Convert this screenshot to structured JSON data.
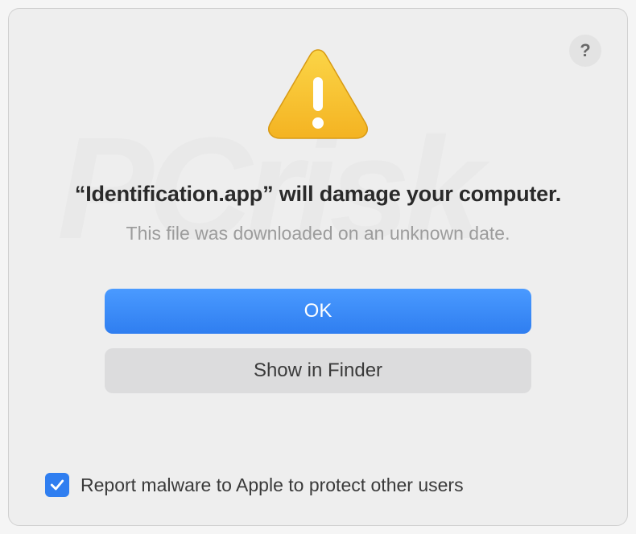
{
  "help": {
    "label": "?"
  },
  "alert": {
    "title": "“Identification.app” will damage your computer.",
    "subtitle": "This file was downloaded on an unknown date."
  },
  "buttons": {
    "ok": "OK",
    "show_in_finder": "Show in Finder"
  },
  "report": {
    "checked": true,
    "label": "Report malware to Apple to protect other users"
  },
  "colors": {
    "primary": "#2f7ef0",
    "background": "#eeeeee",
    "text_muted": "#9c9c9c"
  }
}
